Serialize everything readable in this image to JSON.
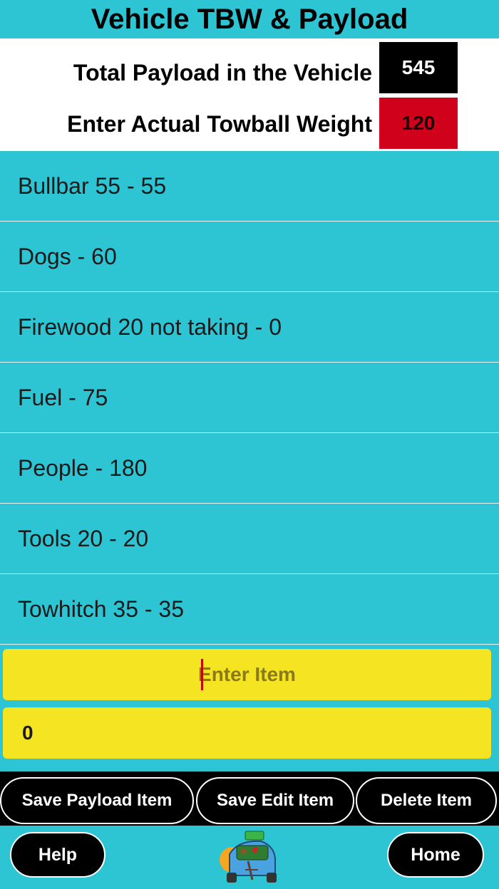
{
  "header": {
    "title": "Vehicle TBW & Payload"
  },
  "summary": {
    "payload_label": "Total Payload in the Vehicle",
    "payload_value": "545",
    "towball_label": "Enter Actual Towball Weight",
    "towball_value": "120",
    "payload_color": "#000000",
    "towball_color": "#d0021b"
  },
  "items": [
    "Bullbar 55 - 55",
    "Dogs - 60",
    "Firewood 20 not taking - 0",
    "Fuel - 75",
    "People - 180",
    "Tools 20 - 20",
    "Towhitch 35 - 35"
  ],
  "form": {
    "item_placeholder": "Enter Item",
    "quantity_value": "0"
  },
  "actions": {
    "save_payload": "Save Payload Item",
    "save_edit": "Save Edit Item",
    "delete": "Delete Item"
  },
  "footer": {
    "help": "Help",
    "home": "Home",
    "logo_icon": "car-loaded-icon"
  },
  "colors": {
    "background": "#2dc4d4",
    "input_yellow": "#f5e421"
  }
}
